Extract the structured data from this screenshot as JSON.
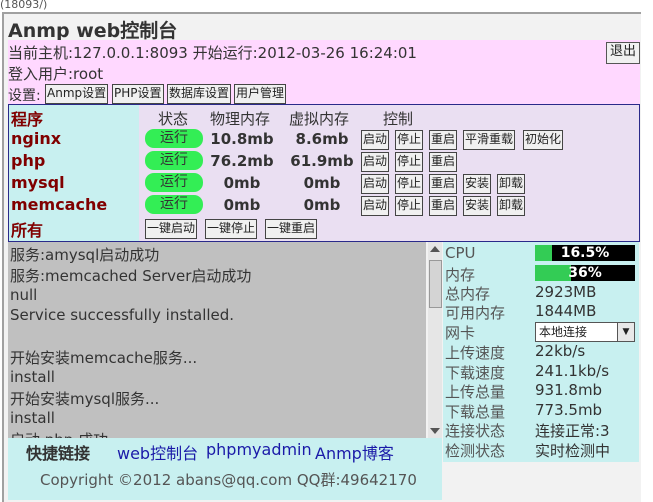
{
  "url_fragment": "(18093/)",
  "app": {
    "title": "Anmp web控制台"
  },
  "host_line": "当前主机:127.0.0.1:8093 开始运行:2012-03-26 16:24:01",
  "user_line": "登入用户:root",
  "logout_label": "退出",
  "settings": {
    "label": "设置:",
    "buttons": [
      "Anmp设置",
      "PHP设置",
      "数据库设置",
      "用户管理"
    ]
  },
  "process_table": {
    "headers": {
      "program": "程序",
      "status": "状态",
      "physical": "物理内存",
      "virtual": "虚拟内存",
      "control": "控制"
    },
    "rows": [
      {
        "name": "nginx",
        "status": "运行",
        "physical": "10.8mb",
        "virtual": "8.6mb",
        "actions": [
          "启动",
          "停止",
          "重启",
          "平滑重载",
          "初始化"
        ]
      },
      {
        "name": "php",
        "status": "运行",
        "physical": "76.2mb",
        "virtual": "61.9mb",
        "actions": [
          "启动",
          "停止",
          "重启"
        ]
      },
      {
        "name": "mysql",
        "status": "运行",
        "physical": "0mb",
        "virtual": "0mb",
        "actions": [
          "启动",
          "停止",
          "重启",
          "安装",
          "卸载"
        ]
      },
      {
        "name": "memcache",
        "status": "运行",
        "physical": "0mb",
        "virtual": "0mb",
        "actions": [
          "启动",
          "停止",
          "重启",
          "安装",
          "卸载"
        ]
      }
    ],
    "all_row": {
      "name": "所有",
      "actions": [
        "一键启动",
        "一键停止",
        "一键重启"
      ]
    }
  },
  "log_lines": [
    "服务:amysql启动成功",
    "服务:memcached Server启动成功",
    "null",
    "Service successfully installed.",
    "",
    "开始安装memcache服务...",
    "install",
    "开始安装mysql服务...",
    "install",
    "启动 php 成功"
  ],
  "stats": {
    "cpu_label": "CPU",
    "cpu_value": "16.5%",
    "cpu_fraction": 0.165,
    "mem_label": "内存",
    "mem_value": "36%",
    "mem_fraction": 0.36,
    "total_mem_label": "总内存",
    "total_mem_value": "2923MB",
    "free_mem_label": "可用内存",
    "free_mem_value": "1844MB",
    "nic_label": "网卡",
    "nic_value": "本地连接",
    "up_speed_label": "上传速度",
    "up_speed_value": "22kb/s",
    "down_speed_label": "下载速度",
    "down_speed_value": "241.1kb/s",
    "up_total_label": "上传总量",
    "up_total_value": "931.8mb",
    "down_total_label": "下载总量",
    "down_total_value": "773.5mb",
    "conn_label": "连接状态",
    "conn_value": "连接正常:3",
    "check_label": "检测状态",
    "check_value": "实时检测中"
  },
  "quick_links": {
    "label": "快捷链接",
    "links": [
      "web控制台",
      "phpmyadmin",
      "Anmp博客"
    ]
  },
  "copyright": "Copyright ©2012 abans@qq.com QQ群:49642170",
  "colors": {
    "running": "#33ee55",
    "pink": "#ffd8ff",
    "cyan": "#c8f0f0",
    "program_red": "#800000",
    "link_blue": "#1a1aa8"
  }
}
